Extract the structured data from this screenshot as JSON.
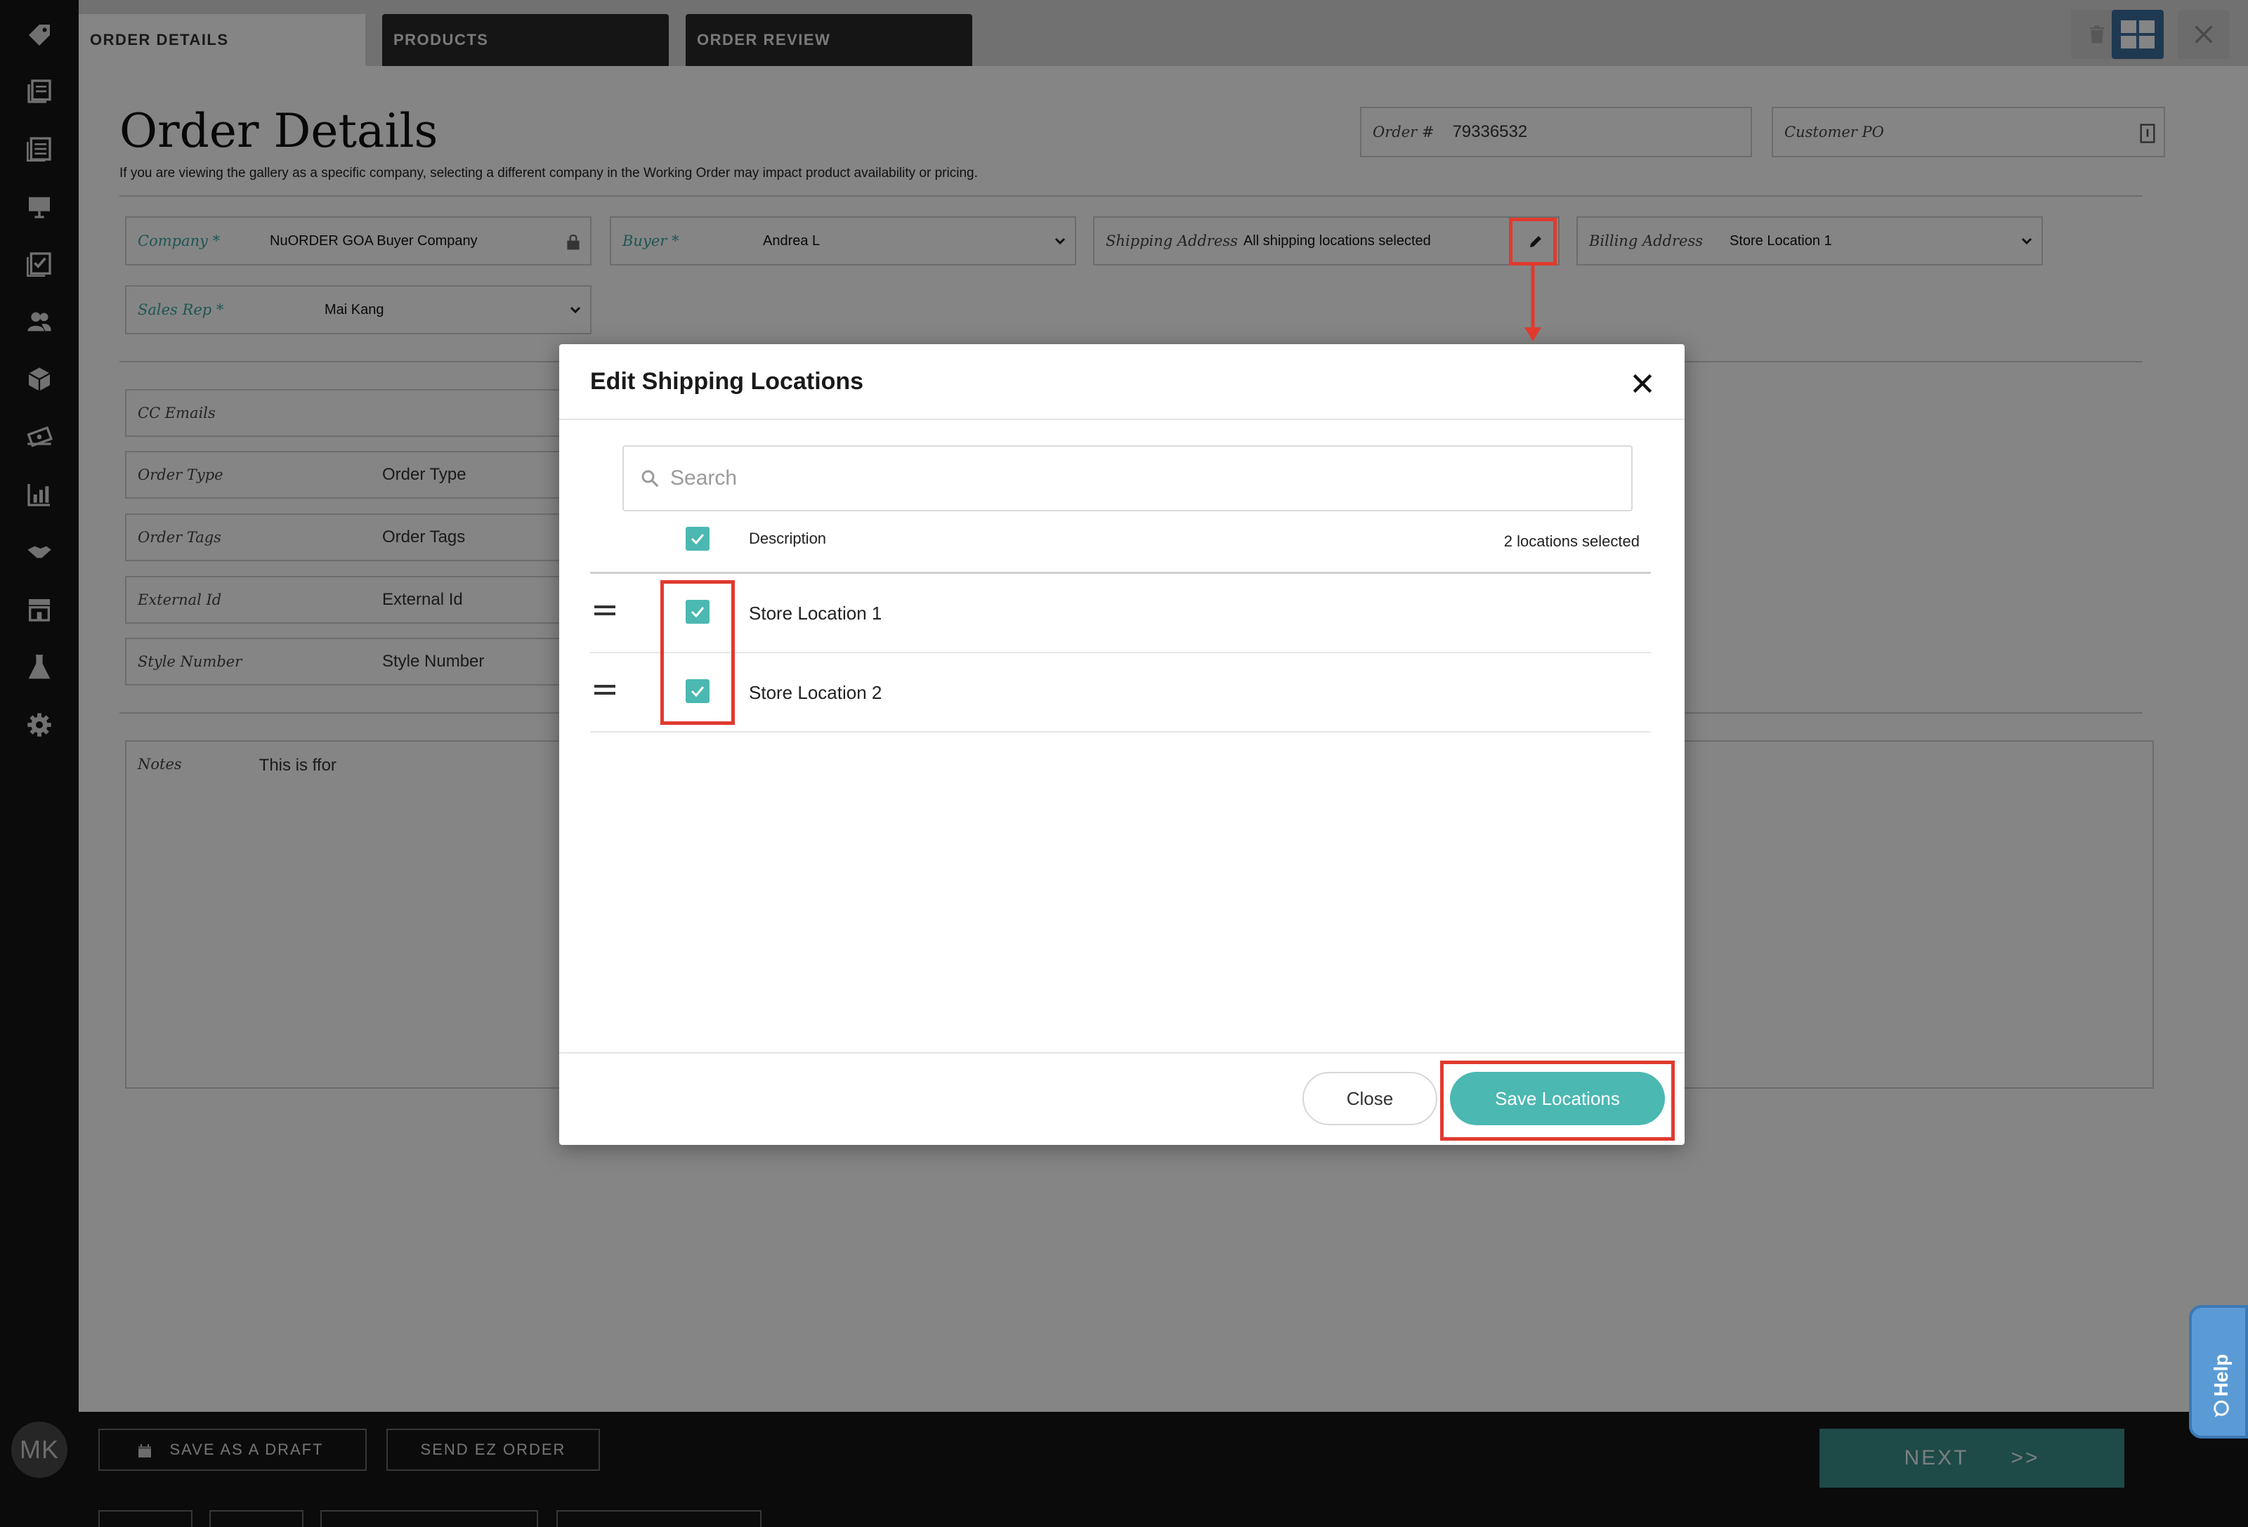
{
  "tabs": [
    {
      "label": "ORDER DETAILS",
      "active": true
    },
    {
      "label": "PRODUCTS",
      "active": false
    },
    {
      "label": "ORDER REVIEW",
      "active": false
    }
  ],
  "toolbar": {
    "trash_icon": "trash-icon",
    "grid_icon": "grid-icon",
    "close_icon": "close-icon"
  },
  "page": {
    "title": "Order Details",
    "subtitle": "If you are viewing the gallery as a specific company, selecting a different company in the Working Order may impact product availability or pricing."
  },
  "header_fields": {
    "order_label": "Order #",
    "order_value": "79336532",
    "customer_po_label": "Customer PO"
  },
  "fields": {
    "company_label": "Company *",
    "company_value": "NuORDER GOA Buyer Company",
    "buyer_label": "Buyer *",
    "buyer_value": "Andrea L",
    "shipping_label": "Shipping Address",
    "shipping_value": "All shipping locations selected",
    "billing_label": "Billing Address",
    "billing_value": "Store Location 1",
    "sales_rep_label": "Sales Rep *",
    "sales_rep_value": "Mai Kang",
    "cc_emails_label": "CC Emails",
    "order_type_label": "Order Type",
    "order_type_placeholder": "Order Type",
    "order_tags_label": "Order Tags",
    "order_tags_placeholder": "Order Tags",
    "external_id_label": "External Id",
    "external_id_placeholder": "External Id",
    "style_number_label": "Style Number",
    "style_number_placeholder": "Style Number",
    "notes_label": "Notes",
    "notes_value": "This is ffor"
  },
  "modal": {
    "title": "Edit Shipping Locations",
    "search_placeholder": "Search",
    "column_description": "Description",
    "selected_count": "2 locations selected",
    "locations": [
      {
        "label": "Store Location 1",
        "checked": true
      },
      {
        "label": "Store Location 2",
        "checked": true
      }
    ],
    "close_label": "Close",
    "save_label": "Save Locations"
  },
  "bottom": {
    "save_draft_label": "SAVE AS A DRAFT",
    "send_ez_label": "SEND EZ ORDER",
    "next_label": "NEXT",
    "next_arrows": ">>"
  },
  "user": {
    "initials": "MK"
  },
  "help": {
    "label": "Help"
  },
  "colors": {
    "accent_teal": "#4bb8b1",
    "annotation_red": "#e03a2e",
    "sidebar_bg": "#161616",
    "help_blue": "#5b9bd5"
  },
  "sidebar_icons": [
    "tag-icon",
    "catalog-icon",
    "list-icon",
    "presentation-icon",
    "checklist-icon",
    "users-icon",
    "box-icon",
    "money-icon",
    "chart-icon",
    "handshake-icon",
    "store-icon",
    "flask-icon",
    "gear-icon"
  ]
}
